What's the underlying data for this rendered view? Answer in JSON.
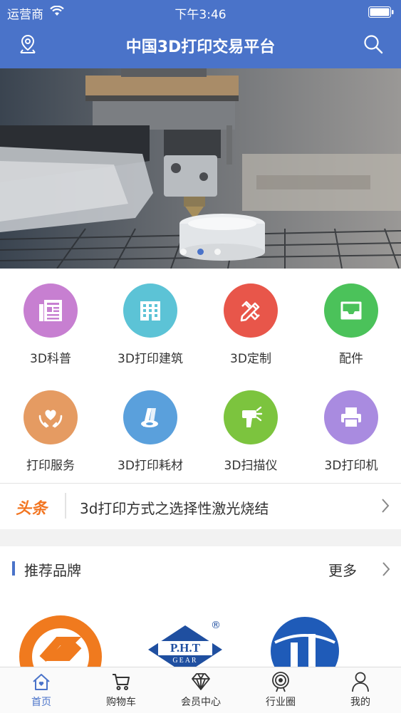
{
  "status_bar": {
    "carrier": "运营商",
    "time": "下午3:46"
  },
  "nav": {
    "title": "中国3D打印交易平台"
  },
  "banner": {
    "page_count": 3,
    "active_index": 1
  },
  "categories": [
    {
      "label": "3D科普",
      "color": "#c77fd1",
      "icon": "newspaper-icon"
    },
    {
      "label": "3D打印建筑",
      "color": "#5cc3d6",
      "icon": "building-icon"
    },
    {
      "label": "3D定制",
      "color": "#e8564a",
      "icon": "pencil-ruler-icon"
    },
    {
      "label": "配件",
      "color": "#4bc25a",
      "icon": "inbox-tray-icon"
    },
    {
      "label": "打印服务",
      "color": "#e59b62",
      "icon": "heart-hands-icon"
    },
    {
      "label": "3D打印耗材",
      "color": "#5aa0dc",
      "icon": "filament-rolls-icon"
    },
    {
      "label": "3D扫描仪",
      "color": "#7cc43e",
      "icon": "scanner-icon"
    },
    {
      "label": "3D打印机",
      "color": "#a98be0",
      "icon": "printer-icon"
    }
  ],
  "headline": {
    "tag": "头条",
    "text": "3d打印方式之选择性激光烧结"
  },
  "brands": {
    "title": "推荐品牌",
    "more": "更多",
    "pht_label": "P.H.T",
    "pht_sub": "GEAR",
    "registered": "®"
  },
  "tabbar": [
    {
      "label": "首页",
      "icon": "home-icon",
      "active": true
    },
    {
      "label": "购物车",
      "icon": "cart-icon",
      "active": false
    },
    {
      "label": "会员中心",
      "icon": "diamond-icon",
      "active": false
    },
    {
      "label": "行业圈",
      "icon": "target-icon",
      "active": false
    },
    {
      "label": "我的",
      "icon": "person-icon",
      "active": false
    }
  ],
  "colors": {
    "brand_blue": "#4a73c9",
    "headline_orange": "#f27521"
  }
}
